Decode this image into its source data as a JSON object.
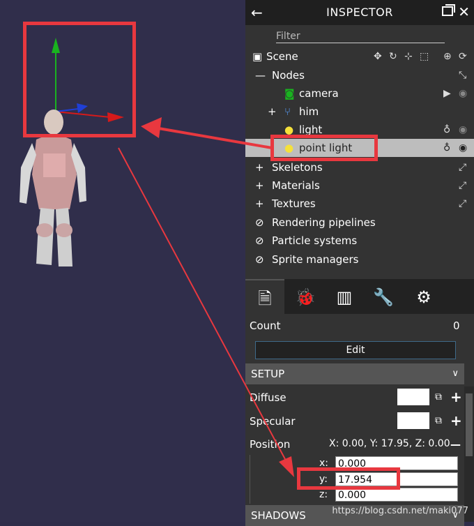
{
  "header": {
    "title": "INSPECTOR",
    "back_icon": "←",
    "close_icon": "✕"
  },
  "filter": {
    "placeholder": "Filter"
  },
  "tree": {
    "scene": "Scene",
    "nodes": "Nodes",
    "camera": "camera",
    "him": "him",
    "light": "light",
    "point_light": "point light",
    "skeletons": "Skeletons",
    "materials": "Materials",
    "textures": "Textures",
    "rendering": "Rendering pipelines",
    "particles": "Particle systems",
    "sprites": "Sprite managers"
  },
  "props": {
    "count_label": "Count",
    "count_value": "0",
    "edit_label": "Edit",
    "setup_label": "SETUP",
    "diffuse_label": "Diffuse",
    "specular_label": "Specular",
    "position_label": "Position",
    "position_value": "X: 0.00, Y: 17.95, Z: 0.00",
    "x_label": "x:",
    "x_value": "0.000",
    "y_label": "y:",
    "y_value": "17.954",
    "z_label": "z:",
    "z_value": "0.000",
    "shadows_label": "SHADOWS"
  },
  "watermark": "https://blog.csdn.net/maki077",
  "colors": {
    "accent_red": "#e8383f",
    "axis_green": "#19b31f",
    "axis_blue": "#1f3fd6",
    "axis_red": "#d61a1a",
    "light_yellow": "#f5e13b"
  }
}
